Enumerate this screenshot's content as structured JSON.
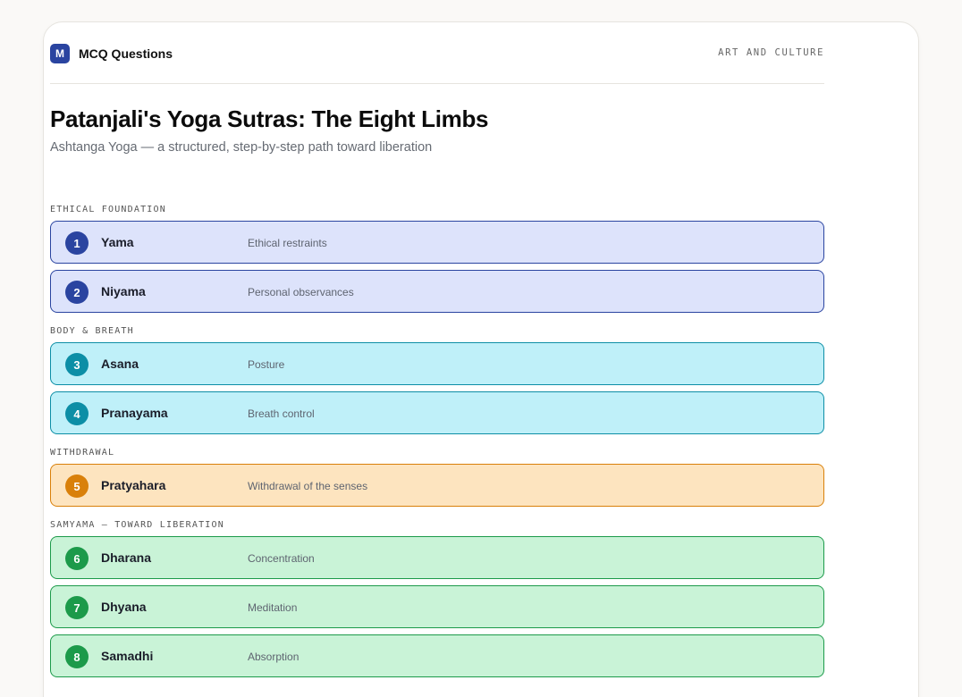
{
  "header": {
    "brand_mark": "M",
    "brand_name": "MCQ Questions",
    "category": "ART AND CULTURE"
  },
  "title": "Patanjali's Yoga Sutras: The Eight Limbs",
  "subtitle": "Ashtanga Yoga — a structured, step-by-step path toward liberation",
  "sections": [
    {
      "label": "ETHICAL FOUNDATION",
      "color": "#2a44a0",
      "limbs": [
        {
          "number": "1",
          "name": "Yama",
          "description": "Ethical restraints"
        },
        {
          "number": "2",
          "name": "Niyama",
          "description": "Personal observances"
        }
      ]
    },
    {
      "label": "BODY & BREATH",
      "color": "#0c8ea6",
      "limbs": [
        {
          "number": "3",
          "name": "Asana",
          "description": "Posture"
        },
        {
          "number": "4",
          "name": "Pranayama",
          "description": "Breath control"
        }
      ]
    },
    {
      "label": "WITHDRAWAL",
      "color": "#d9800a",
      "limbs": [
        {
          "number": "5",
          "name": "Pratyahara",
          "description": "Withdrawal of the senses"
        }
      ]
    },
    {
      "label": "SAMYAMA — TOWARD LIBERATION",
      "color": "#1c9a4a",
      "limbs": [
        {
          "number": "6",
          "name": "Dharana",
          "description": "Concentration"
        },
        {
          "number": "7",
          "name": "Dhyana",
          "description": "Meditation"
        },
        {
          "number": "8",
          "name": "Samadhi",
          "description": "Absorption"
        }
      ]
    }
  ]
}
